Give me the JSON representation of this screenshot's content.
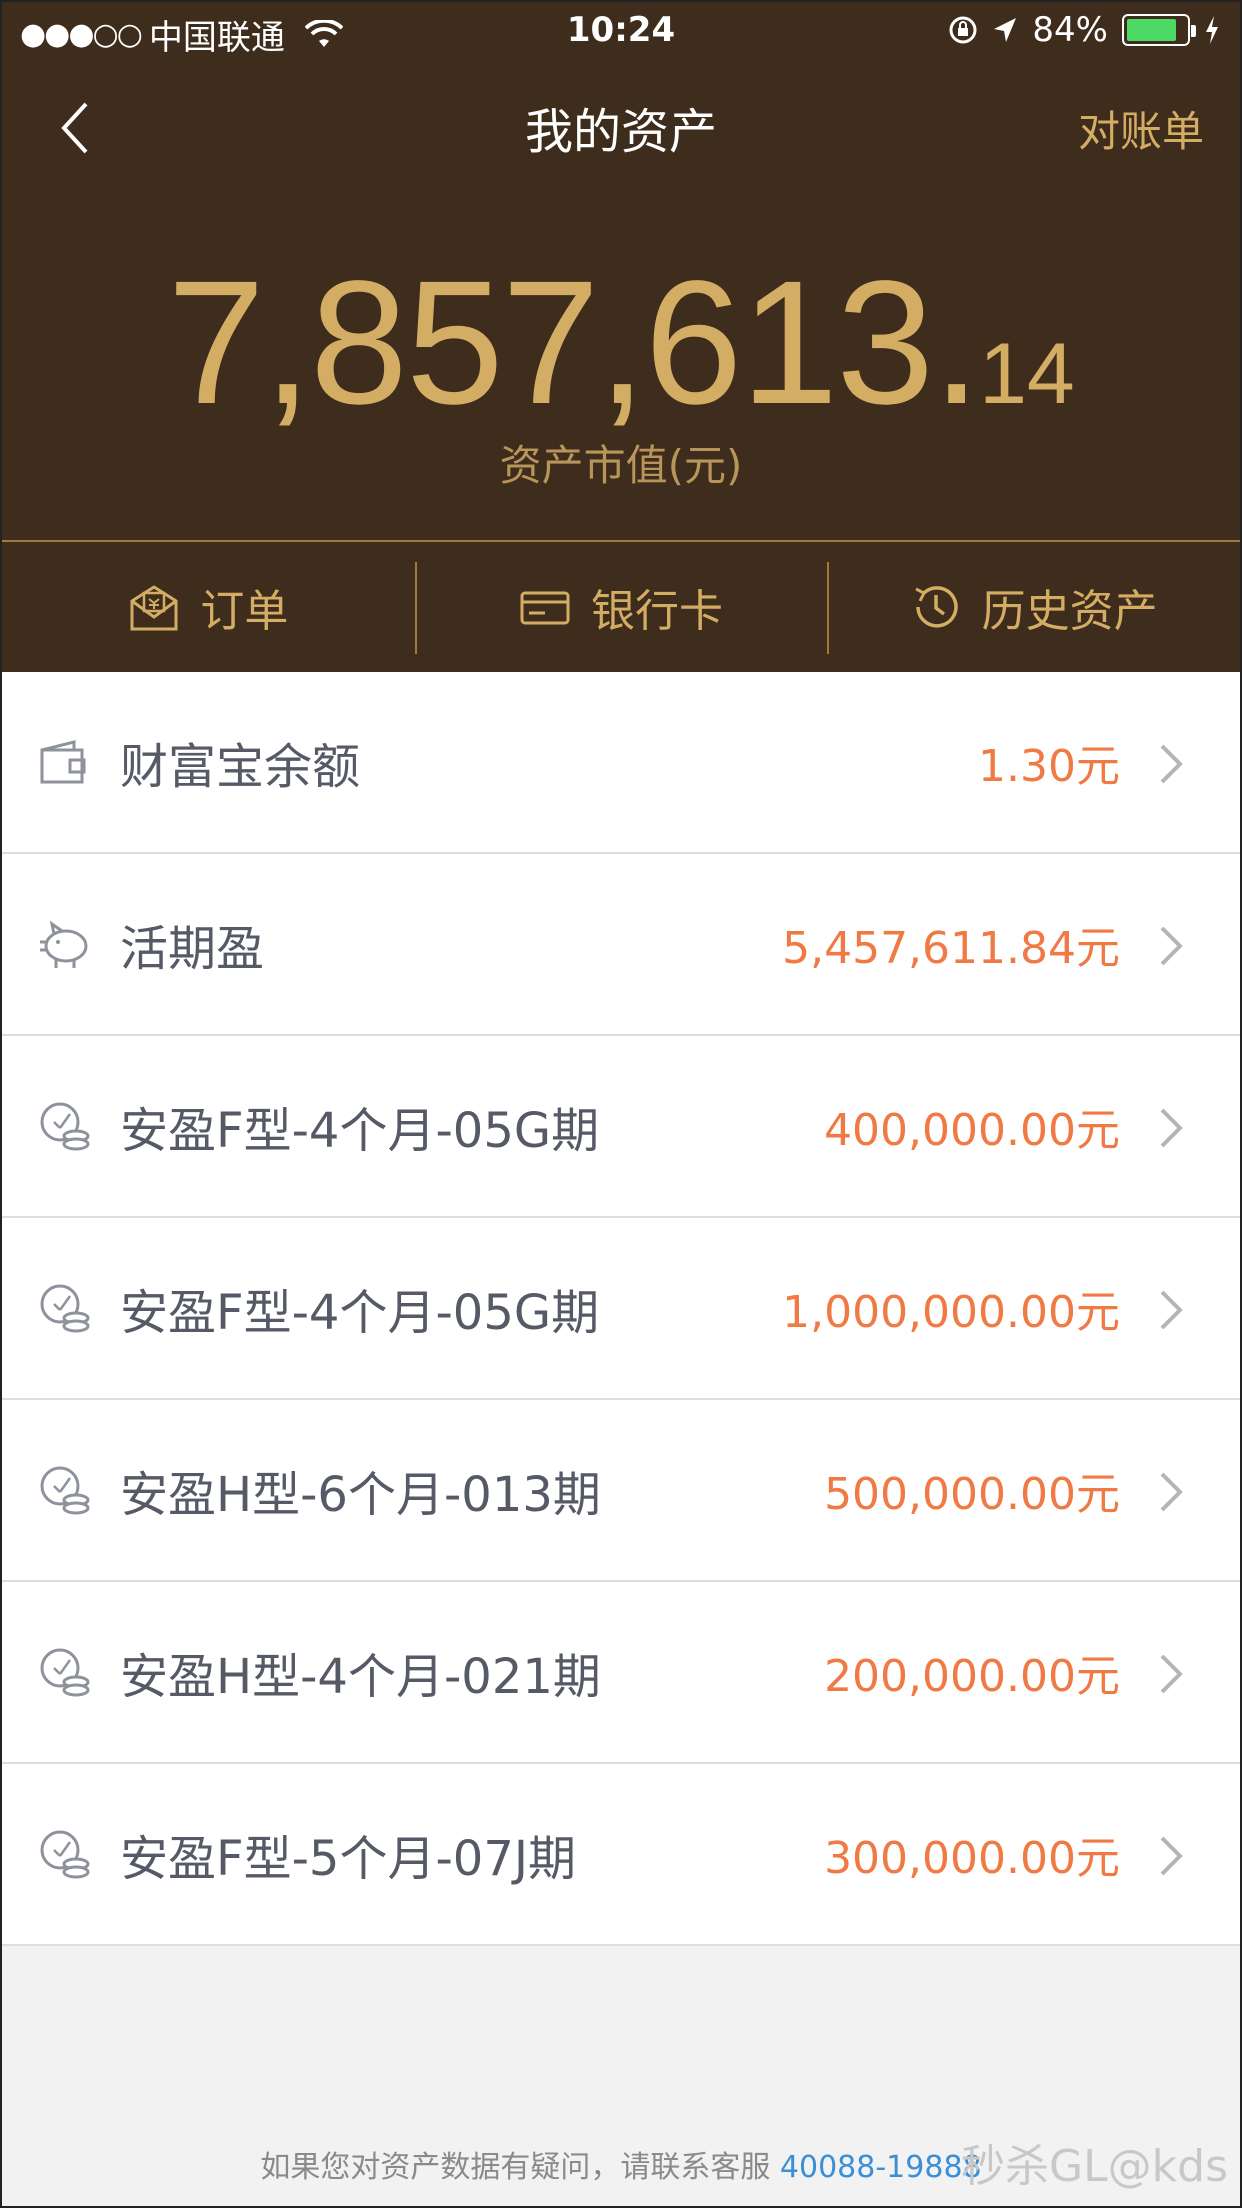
{
  "status_bar": {
    "carrier": "中国联通",
    "time": "10:24",
    "battery_percent": "84%",
    "battery_level": 0.84,
    "signal": "●●●○○"
  },
  "nav": {
    "title": "我的资产",
    "right_action": "对账单"
  },
  "summary": {
    "amount_int": "7,857,613.",
    "amount_dec": "14",
    "label": "资产市值(元)"
  },
  "quick_links": [
    {
      "label": "订单",
      "icon": "order-envelope-icon"
    },
    {
      "label": "银行卡",
      "icon": "bank-card-icon"
    },
    {
      "label": "历史资产",
      "icon": "history-clock-icon"
    }
  ],
  "assets": [
    {
      "label": "财富宝余额",
      "value": "1.30元",
      "icon": "wallet-icon"
    },
    {
      "label": "活期盈",
      "value": "5,457,611.84元",
      "icon": "piggy-bank-icon"
    },
    {
      "label": "安盈F型-4个月-05G期",
      "value": "400,000.00元",
      "icon": "coin-stack-icon"
    },
    {
      "label": "安盈F型-4个月-05G期",
      "value": "1,000,000.00元",
      "icon": "coin-stack-icon"
    },
    {
      "label": "安盈H型-6个月-013期",
      "value": "500,000.00元",
      "icon": "coin-stack-icon"
    },
    {
      "label": "安盈H型-4个月-021期",
      "value": "200,000.00元",
      "icon": "coin-stack-icon"
    },
    {
      "label": "安盈F型-5个月-07J期",
      "value": "300,000.00元",
      "icon": "coin-stack-icon"
    }
  ],
  "footer": {
    "text": "如果您对资产数据有疑问，请联系客服",
    "phone": "40088-19888"
  },
  "watermark": "秒杀GL@kds",
  "colors": {
    "header_bg": "#3e2c1c",
    "gold": "#d4ad64",
    "value_orange": "#f07a44",
    "link_blue": "#3a8fd6"
  }
}
